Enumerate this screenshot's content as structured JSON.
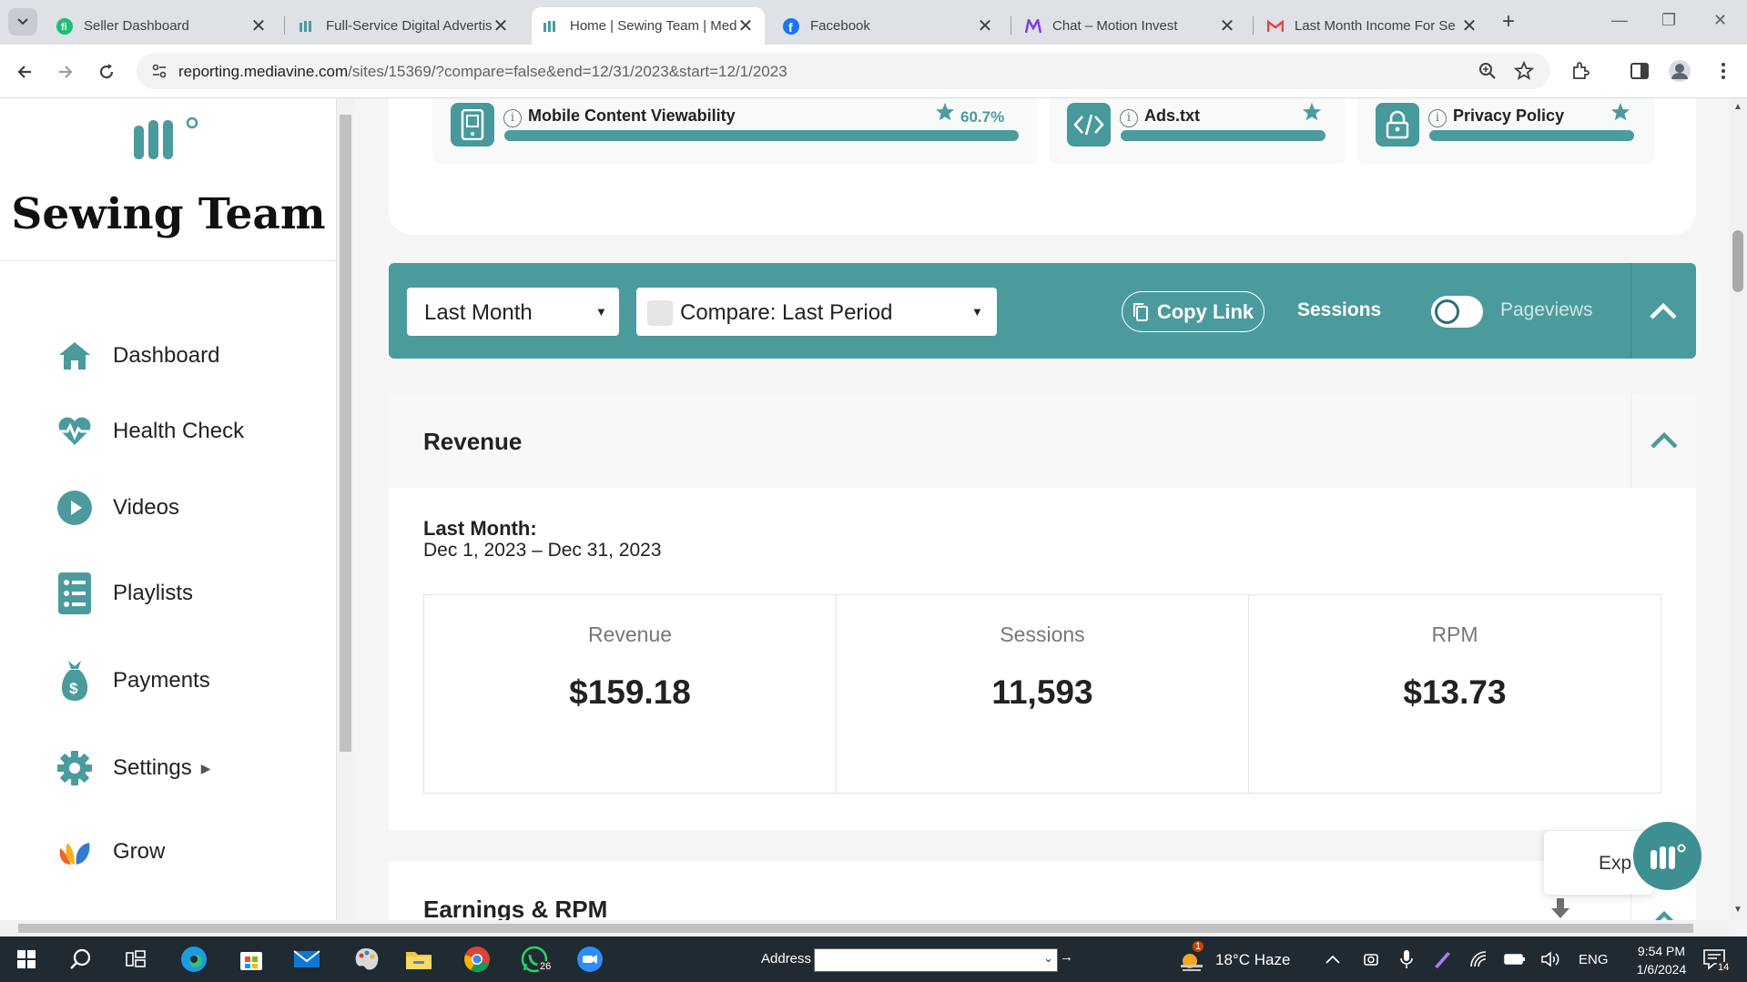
{
  "browser": {
    "tabs": [
      {
        "title": "Seller Dashboard",
        "icon": "fiverr-icon"
      },
      {
        "title": "Full-Service Digital Advertis",
        "icon": "mediavine-icon"
      },
      {
        "title": "Home | Sewing Team | Med",
        "icon": "mediavine-icon",
        "active": true
      },
      {
        "title": "Facebook",
        "icon": "facebook-icon"
      },
      {
        "title": "Chat – Motion Invest",
        "icon": "motion-invest-icon"
      },
      {
        "title": "Last Month Income For Se",
        "icon": "gmail-icon"
      }
    ],
    "url_host": "reporting.mediavine.com",
    "url_path": "/sites/15369/?compare=false&end=12/31/2023&start=12/1/2023"
  },
  "sidebar": {
    "site_name": "Sewing Team",
    "items": [
      {
        "label": "Dashboard",
        "icon": "home-icon"
      },
      {
        "label": "Health Check",
        "icon": "heartbeat-icon"
      },
      {
        "label": "Videos",
        "icon": "play-icon"
      },
      {
        "label": "Playlists",
        "icon": "playlist-icon"
      },
      {
        "label": "Payments",
        "icon": "money-bag-icon"
      },
      {
        "label": "Settings",
        "icon": "gear-icon"
      },
      {
        "label": "Grow",
        "icon": "grow-icon"
      }
    ]
  },
  "health_checks": [
    {
      "label": "Mobile Content Viewability",
      "value": "60.7%"
    },
    {
      "label": "Ads.txt"
    },
    {
      "label": "Privacy Policy"
    }
  ],
  "filters": {
    "period": "Last Month",
    "compare": "Compare: Last Period",
    "copy_link": "Copy Link",
    "toggle_left": "Sessions",
    "toggle_right": "Pageviews"
  },
  "revenue": {
    "title": "Revenue",
    "period_label": "Last Month:",
    "period_range": "Dec 1, 2023 – Dec 31, 2023",
    "stats": [
      {
        "label": "Revenue",
        "value": "$159.18"
      },
      {
        "label": "Sessions",
        "value": "11,593"
      },
      {
        "label": "RPM",
        "value": "$13.73"
      }
    ]
  },
  "earnings": {
    "title": "Earnings & RPM"
  },
  "explore": {
    "label": "Exp"
  },
  "taskbar": {
    "address_label": "Address",
    "weather": "18°C  Haze",
    "language": "ENG",
    "time": "9:54 PM",
    "date": "1/6/2024",
    "whatsapp_badge": "26",
    "weather_badge": "1",
    "notifications": "14"
  },
  "colors": {
    "accent": "#4b9b9d",
    "brand": "#47999b"
  }
}
